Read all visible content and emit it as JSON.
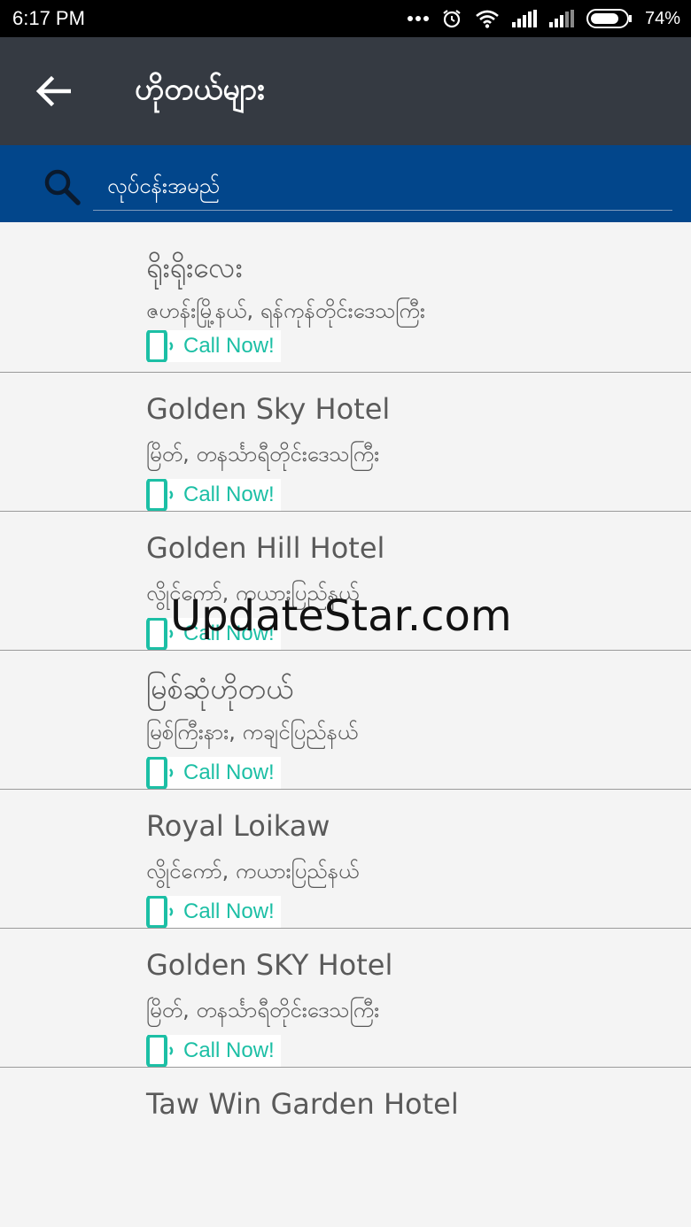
{
  "status_bar": {
    "time": "6:17 PM",
    "battery": "74%"
  },
  "toolbar": {
    "title": "ဟိုတယ်များ"
  },
  "search": {
    "placeholder": "လုပ်ငန်းအမည်"
  },
  "hotels": [
    {
      "name": "ရိုးရိုးလေး",
      "address": "ဇဟန်းမြို့နယ်, ရန်ကုန်တိုင်းဒေသကြီး",
      "call_label": "Call Now!"
    },
    {
      "name": "Golden Sky Hotel",
      "address": "မြိတ်, တနင်္သာရီတိုင်းဒေသကြီး",
      "call_label": "Call Now!"
    },
    {
      "name": "Golden Hill Hotel",
      "address": "လွိုင်ကော်, ကယားပြည်နယ်",
      "call_label": "Call Now!"
    },
    {
      "name": "မြစ်ဆုံဟိုတယ်",
      "address": "မြစ်ကြီးနား, ကချင်ပြည်နယ်",
      "call_label": "Call Now!"
    },
    {
      "name": "Royal Loikaw",
      "address": "လွိုင်ကော်, ကယားပြည်နယ်",
      "call_label": "Call Now!"
    },
    {
      "name": "Golden SKY Hotel",
      "address": "မြိတ်, တနင်္သာရီတိုင်းဒေသကြီး",
      "call_label": "Call Now!"
    },
    {
      "name": "Taw Win Garden Hotel"
    }
  ],
  "watermark": "UpdateStar.com",
  "colors": {
    "toolbar": "#353a42",
    "search_bar": "#02468b",
    "call_accent": "#1cbfa5",
    "list_background": "#f4f4f4"
  }
}
